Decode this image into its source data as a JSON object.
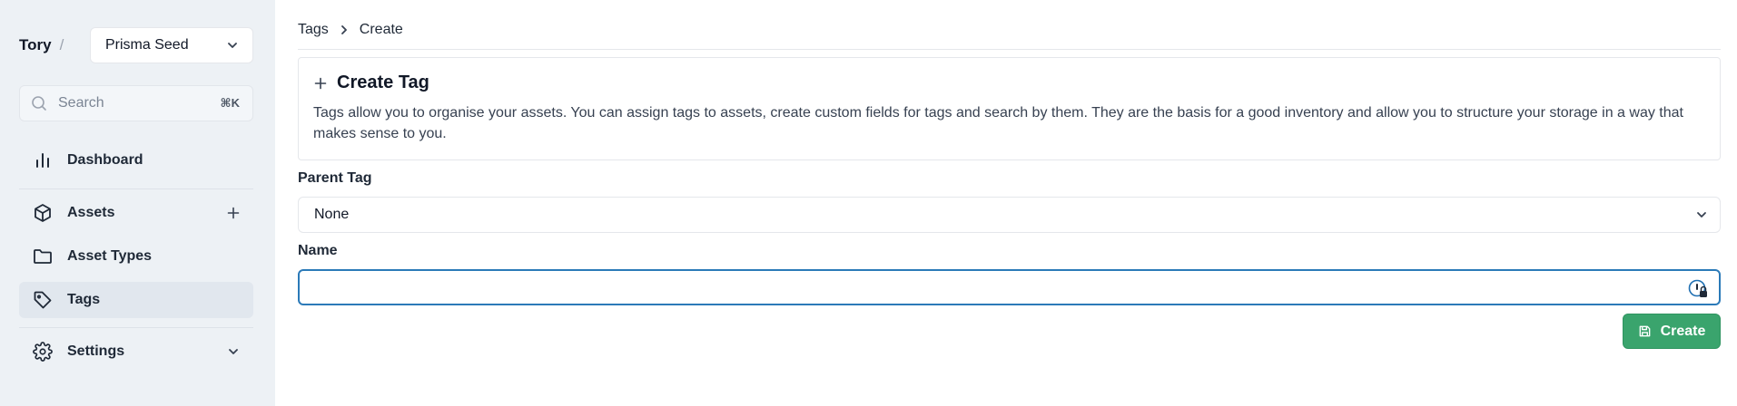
{
  "sidebar": {
    "workspace_owner": "Tory",
    "workspace_separator": "/",
    "workspace_name": "Prisma Seed",
    "search": {
      "placeholder": "Search",
      "shortcut": "⌘K"
    },
    "items": [
      {
        "label": "Dashboard",
        "icon": "bar-chart-icon"
      },
      {
        "label": "Assets",
        "icon": "cube-icon",
        "trailing": "plus-icon"
      },
      {
        "label": "Asset Types",
        "icon": "folder-icon"
      },
      {
        "label": "Tags",
        "icon": "tag-icon",
        "active": true
      },
      {
        "label": "Settings",
        "icon": "gear-icon",
        "trailing": "chevron-down-icon"
      }
    ]
  },
  "breadcrumb": {
    "items": [
      "Tags",
      "Create"
    ]
  },
  "card": {
    "title": "Create Tag",
    "description": "Tags allow you to organise your assets. You can assign tags to assets, create custom fields for tags and search by them. They are the basis for a good inventory and allow you to structure your storage in a way that makes sense to you."
  },
  "form": {
    "parent_label": "Parent Tag",
    "parent_value": "None",
    "name_label": "Name",
    "name_value": ""
  },
  "actions": {
    "create_label": "Create"
  },
  "colors": {
    "sidebar_bg": "#edf1f5",
    "focus_border": "#2b7ab8",
    "primary_button": "#3aa46d"
  }
}
